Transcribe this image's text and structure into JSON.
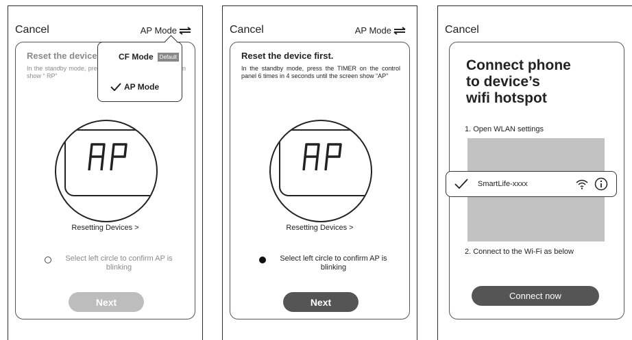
{
  "panel1": {
    "cancel": "Cancel",
    "mode_label": "AP Mode",
    "title": "Reset the device",
    "desc": "In the standby mode, pre control panel 6 times in screen show “ RP”",
    "display": "AP",
    "resetting": "Resetting Devices >",
    "confirm": "Select left circle to confirm AP is blinking",
    "next": "Next",
    "dropdown": {
      "cf_mode": "CF Mode",
      "cf_badge": "Default",
      "ap_mode": "AP Mode"
    }
  },
  "panel2": {
    "cancel": "Cancel",
    "mode_label": "AP Mode",
    "title": "Reset the device first.",
    "desc": "In the standby mode, press the TIMER on the control panel 6 times in 4 seconds until the screen show “AP”",
    "display": "AP",
    "resetting": "Resetting Devices >",
    "confirm": "Select left circle to confirm AP is blinking",
    "next": "Next"
  },
  "panel3": {
    "cancel": "Cancel",
    "title_line1": "Connect phone",
    "title_line2": "to device’s",
    "title_line3": "wifi hotspot",
    "step1": "1. Open WLAN settings",
    "wifi_name": "SmartLife-xxxx",
    "step2": "2. Connect to the Wi-Fi as below",
    "connect": "Connect now"
  },
  "icons": [
    "swap-arrows-icon",
    "check-icon",
    "wifi-icon",
    "info-icon"
  ]
}
